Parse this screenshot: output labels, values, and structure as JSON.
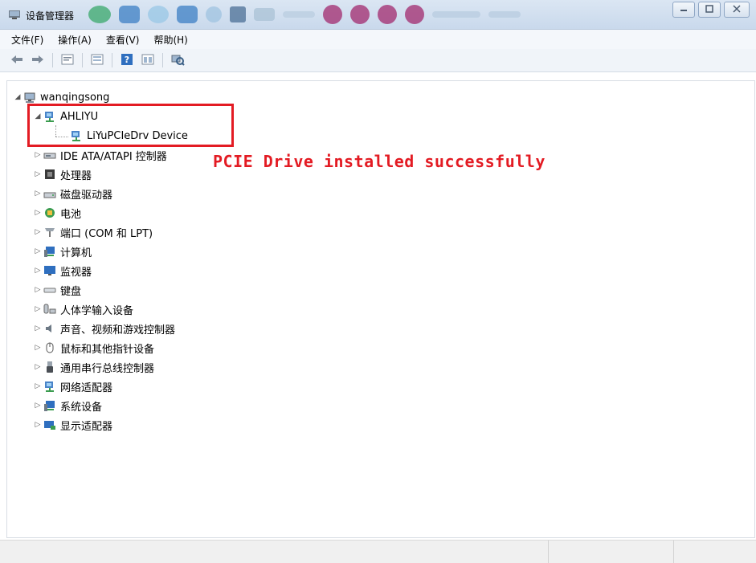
{
  "window": {
    "title": "设备管理器"
  },
  "menu": [
    "文件(F)",
    "操作(A)",
    "查看(V)",
    "帮助(H)"
  ],
  "toolbar": {
    "icons": [
      "back-arrow-icon",
      "forward-arrow-icon",
      "properties-icon",
      "tree-view-icon",
      "help-icon",
      "details-icon",
      "scan-hardware-icon"
    ]
  },
  "tree": {
    "root": "wanqingsong",
    "group": "AHLIYU",
    "device": "LiYuPCIeDrv Device",
    "categories": [
      "IDE ATA/ATAPI 控制器",
      "处理器",
      "磁盘驱动器",
      "电池",
      "端口 (COM 和 LPT)",
      "计算机",
      "监视器",
      "键盘",
      "人体学输入设备",
      "声音、视频和游戏控制器",
      "鼠标和其他指针设备",
      "通用串行总线控制器",
      "网络适配器",
      "系统设备",
      "显示适配器"
    ]
  },
  "annotation": "PCIE Drive installed successfully",
  "colors": {
    "annotation": "#e31b23",
    "titlebar": "#dbe6f3"
  }
}
